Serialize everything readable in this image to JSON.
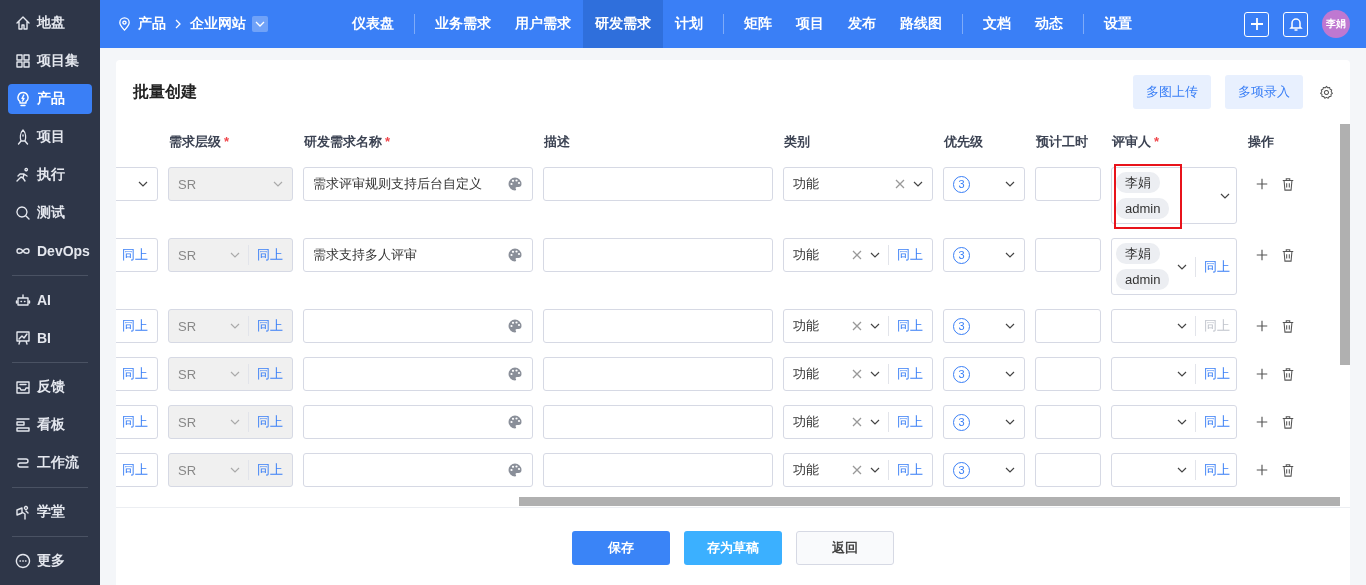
{
  "sidebar": {
    "groups": [
      [
        {
          "label": "地盘",
          "selected": false
        },
        {
          "label": "项目集",
          "selected": false
        },
        {
          "label": "产品",
          "selected": true
        },
        {
          "label": "项目",
          "selected": false
        },
        {
          "label": "执行",
          "selected": false
        },
        {
          "label": "测试",
          "selected": false
        },
        {
          "label": "DevOps",
          "selected": false
        }
      ],
      [
        {
          "label": "AI",
          "selected": false
        },
        {
          "label": "BI",
          "selected": false
        }
      ],
      [
        {
          "label": "反馈",
          "selected": false
        },
        {
          "label": "看板",
          "selected": false
        },
        {
          "label": "工作流",
          "selected": false
        }
      ],
      [
        {
          "label": "学堂",
          "selected": false
        }
      ],
      [
        {
          "label": "更多",
          "selected": false
        }
      ]
    ]
  },
  "topbar": {
    "breadcrumb": {
      "root": "产品",
      "current": "企业网站"
    },
    "nav_groups": [
      [
        {
          "label": "仪表盘",
          "selected": false
        }
      ],
      [
        {
          "label": "业务需求",
          "selected": false
        },
        {
          "label": "用户需求",
          "selected": false
        },
        {
          "label": "研发需求",
          "selected": true
        },
        {
          "label": "计划",
          "selected": false
        }
      ],
      [
        {
          "label": "矩阵",
          "selected": false
        },
        {
          "label": "项目",
          "selected": false
        },
        {
          "label": "发布",
          "selected": false
        },
        {
          "label": "路线图",
          "selected": false
        }
      ],
      [
        {
          "label": "文档",
          "selected": false
        },
        {
          "label": "动态",
          "selected": false
        }
      ],
      [
        {
          "label": "设置",
          "selected": false
        }
      ]
    ],
    "avatar": "李娟"
  },
  "page": {
    "title": "批量创建",
    "actions": [
      "多图上传",
      "多项录入"
    ]
  },
  "table": {
    "columns": [
      {
        "label": "需求层级",
        "required_mark": "*"
      },
      {
        "label": "研发需求名称",
        "required_mark": "*"
      },
      {
        "label": "描述"
      },
      {
        "label": "类别"
      },
      {
        "label": "优先级"
      },
      {
        "label": "预计工时"
      },
      {
        "label": "评审人",
        "required_mark": "*"
      },
      {
        "label": "操作"
      }
    ],
    "rows": [
      {
        "level": "SR",
        "name": "需求评审规则支持后台自定义",
        "category": "功能",
        "priority": "3",
        "reviewers": [
          "李娟",
          "admin"
        ],
        "highlighted": true
      },
      {
        "col_1_copy": "同上",
        "level": "SR",
        "level_copy": "同上",
        "name": "需求支持多人评审",
        "category": "功能",
        "category_copy": "同上",
        "priority": "3",
        "reviewers": [
          "李娟",
          "admin"
        ],
        "reviewers_copy": "同上",
        "reviewers_copy_disabled": false,
        "highlighted": false
      },
      {
        "col_1_copy": "同上",
        "level": "SR",
        "level_copy": "同上",
        "category": "功能",
        "category_copy": "同上",
        "priority": "3",
        "reviewers_copy": "同上",
        "reviewers_copy_disabled": true,
        "highlighted": false
      },
      {
        "col_1_copy": "同上",
        "level": "SR",
        "level_copy": "同上",
        "category": "功能",
        "category_copy": "同上",
        "priority": "3",
        "reviewers_copy": "同上",
        "reviewers_copy_disabled": false,
        "highlighted": false
      },
      {
        "col_1_copy": "同上",
        "level": "SR",
        "level_copy": "同上",
        "category": "功能",
        "category_copy": "同上",
        "priority": "3",
        "reviewers_copy": "同上",
        "reviewers_copy_disabled": false,
        "highlighted": false
      },
      {
        "col_1_copy": "同上",
        "level": "SR",
        "level_copy": "同上",
        "category": "功能",
        "category_copy": "同上",
        "priority": "3",
        "reviewers_copy": "同上",
        "reviewers_copy_disabled": false,
        "highlighted": false
      }
    ]
  },
  "buttons": [
    {
      "label": "保存",
      "kind": "primary"
    },
    {
      "label": "存为草稿",
      "kind": "secondary"
    },
    {
      "label": "返回",
      "kind": "default"
    }
  ]
}
